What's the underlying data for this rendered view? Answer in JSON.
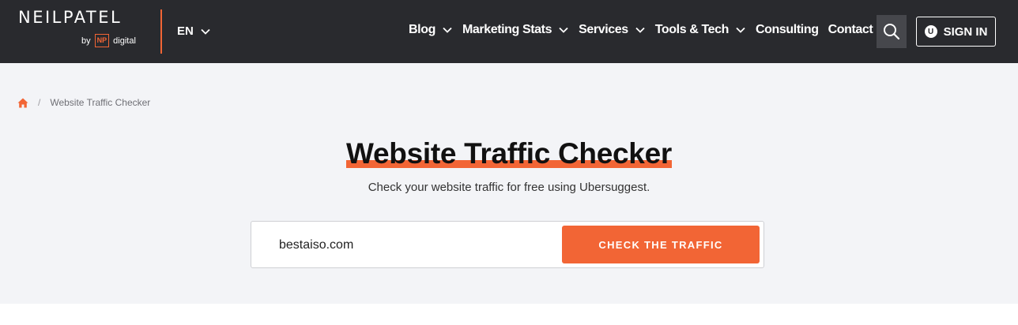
{
  "header": {
    "logo_text": "NEILPATEL",
    "logo_by": "by",
    "logo_np": "NP",
    "logo_digital": "digital",
    "language": "EN",
    "nav": [
      {
        "label": "Blog",
        "dropdown": true
      },
      {
        "label": "Marketing Stats",
        "dropdown": true
      },
      {
        "label": "Services",
        "dropdown": true
      },
      {
        "label": "Tools & Tech",
        "dropdown": true
      },
      {
        "label": "Consulting",
        "dropdown": false
      },
      {
        "label": "Contact",
        "dropdown": false
      }
    ],
    "search_icon": "search-icon",
    "signin_label": "SIGN IN",
    "signin_icon_letter": "U"
  },
  "breadcrumb": {
    "home_icon": "home-icon",
    "separator": "/",
    "current": "Website Traffic Checker"
  },
  "hero": {
    "title": "Website Traffic Checker",
    "subtitle": "Check your website traffic for free using Ubersuggest."
  },
  "form": {
    "input_value": "bestaiso.com",
    "button_label": "CHECK THE TRAFFIC"
  },
  "colors": {
    "header_bg": "#292a2e",
    "accent": "#f26535",
    "hero_bg": "#f3f4f7"
  }
}
